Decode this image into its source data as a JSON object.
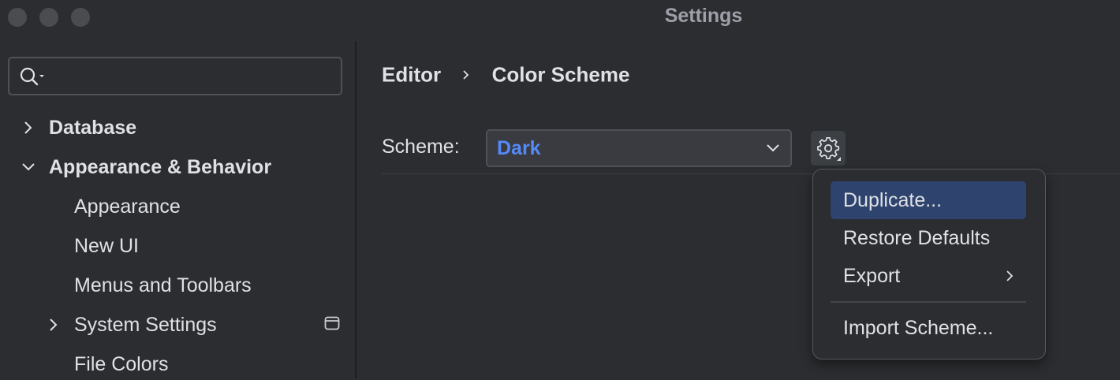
{
  "window": {
    "title": "Settings",
    "controls": [
      "close",
      "minimize",
      "zoom"
    ]
  },
  "sidebar": {
    "search": {
      "value": "",
      "placeholder": ""
    },
    "items": [
      {
        "label": "Database",
        "level": 0,
        "expanded": false,
        "bold": true
      },
      {
        "label": "Appearance & Behavior",
        "level": 0,
        "expanded": true,
        "bold": true
      },
      {
        "label": "Appearance",
        "level": 1
      },
      {
        "label": "New UI",
        "level": 1
      },
      {
        "label": "Menus and Toolbars",
        "level": 1
      },
      {
        "label": "System Settings",
        "level": 1,
        "expanded": false
      },
      {
        "label": "File Colors",
        "level": 1,
        "icon": "project-level-icon"
      }
    ]
  },
  "breadcrumb": {
    "parent": "Editor",
    "current": "Color Scheme"
  },
  "scheme": {
    "label": "Scheme:",
    "value": "Dark"
  },
  "gear_menu": {
    "items": [
      {
        "label": "Duplicate...",
        "selected": true
      },
      {
        "label": "Restore Defaults"
      },
      {
        "label": "Export",
        "submenu": true
      },
      {
        "label": "Import Scheme..."
      }
    ]
  },
  "colors": {
    "background": "#2b2d30",
    "accent": "#548af7",
    "selection": "#2e436e",
    "text": "#dfe1e5"
  }
}
